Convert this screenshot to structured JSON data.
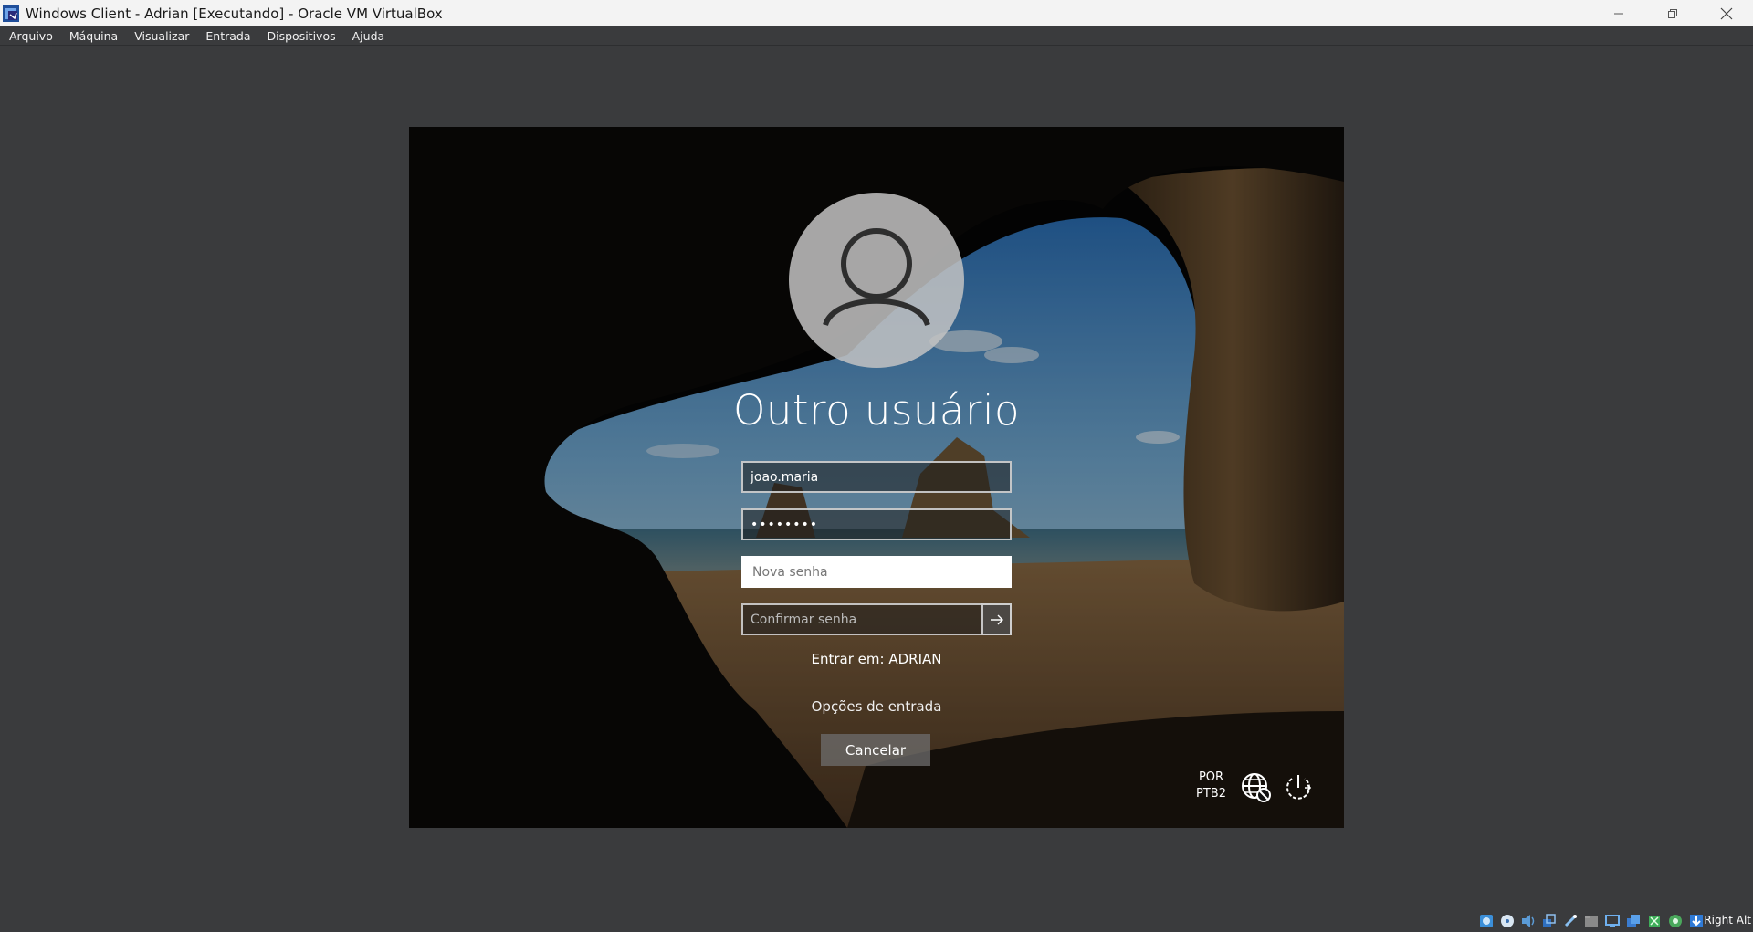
{
  "window": {
    "title": "Windows Client - Adrian [Executando] - Oracle VM VirtualBox"
  },
  "menu": {
    "items": [
      {
        "label": "Arquivo"
      },
      {
        "label": "Máquina"
      },
      {
        "label": "Visualizar"
      },
      {
        "label": "Entrada"
      },
      {
        "label": "Dispositivos"
      },
      {
        "label": "Ajuda"
      }
    ]
  },
  "login": {
    "user_name": "Outro usuário",
    "username_value": "joao.maria",
    "password_mask": "••••••••",
    "new_password_placeholder": "Nova senha",
    "confirm_password_placeholder": "Confirmar senha",
    "domain_text": "Entrar em: ADRIAN",
    "options_link": "Opções de entrada",
    "cancel_label": "Cancelar",
    "language_line1": "POR",
    "language_line2": "PTB2",
    "icons": {
      "avatar": "user-avatar-icon",
      "submit": "arrow-right-icon",
      "network": "network-globe-icon",
      "power": "power-icon"
    }
  },
  "statusbar": {
    "host_key": "Right Alt",
    "icons": [
      "hard-disk-icon",
      "optical-drive-icon",
      "audio-icon",
      "network-icon",
      "usb-icon",
      "shared-folders-icon",
      "display-icon",
      "recording-icon",
      "mouse-integration-icon",
      "keyboard-capture-icon",
      "arrow-down-icon"
    ]
  },
  "colors": {
    "chrome_bg": "#3a3b3d",
    "titlebar_bg": "#f3f3f3",
    "vm_bg": "#050505"
  }
}
